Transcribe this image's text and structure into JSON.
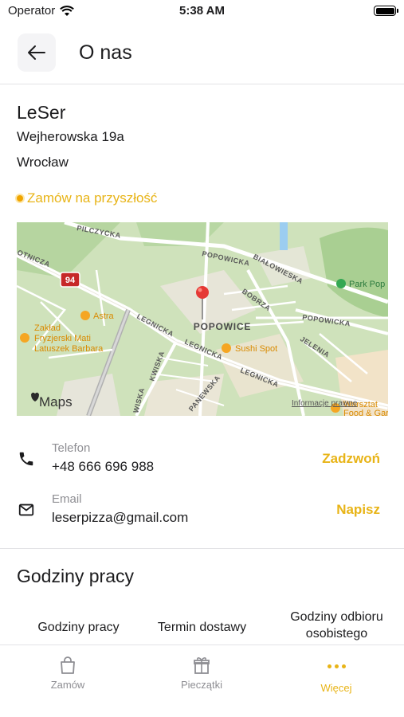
{
  "status_bar": {
    "carrier": "Operator",
    "time": "5:38 AM"
  },
  "header": {
    "title": "O nas"
  },
  "restaurant": {
    "name": "LeSer",
    "address_line1": "Wejherowska 19a",
    "address_line2": "Wrocław",
    "order_future_label": "Zamów na przyszłość"
  },
  "map": {
    "badge": "94",
    "district": "POPOWICE",
    "streets": [
      "PILCZYCKA",
      "POPOWICKA",
      "BIAŁOWIESKA",
      "BOBRZA",
      "POPOWICKA",
      "JELENIA",
      "LEGNICKA",
      "LEGNICKA",
      "KWISKA",
      "LEGNICKA",
      "OTNICZA",
      "PANEWSKA",
      "WISKA"
    ],
    "pois": [
      "Astra",
      "Zakład",
      "Fryzjerski Mati",
      "Latuszek Barbara",
      "Sushi Spot",
      "Park Pop",
      "Warsztat",
      "Food & Garde"
    ],
    "brand": "Maps",
    "legal": "Informacje prawne"
  },
  "contacts": [
    {
      "label": "Telefon",
      "value": "+48 666 696 988",
      "action": "Zadzwoń"
    },
    {
      "label": "Email",
      "value": "leserpizza@gmail.com",
      "action": "Napisz"
    }
  ],
  "hours": {
    "title": "Godziny pracy",
    "tabs": [
      "Godziny pracy",
      "Termin dostawy",
      "Godziny odbioru osobistego"
    ]
  },
  "bottom_nav": [
    {
      "label": "Zamów",
      "icon": "shopping-bag-icon"
    },
    {
      "label": "Pieczątki",
      "icon": "gift-icon"
    },
    {
      "label": "Więcej",
      "icon": "more-dots-icon"
    }
  ],
  "colors": {
    "accent": "#e8b417",
    "map_green": "#d3e4c0",
    "pin": "#e53935"
  }
}
